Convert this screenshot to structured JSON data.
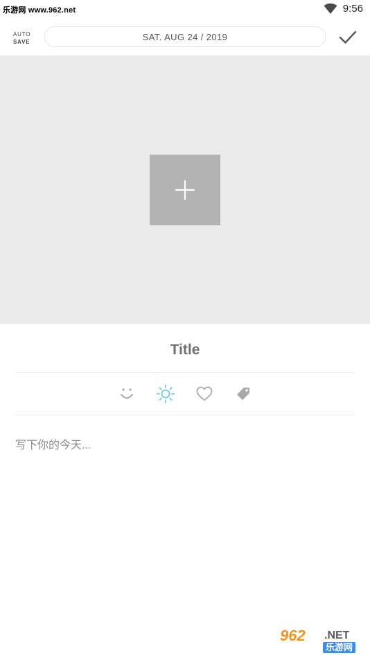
{
  "status_bar": {
    "watermark": "乐游网 www.962.net",
    "time": "9:56"
  },
  "toolbar": {
    "autosave_line1": "AUTO",
    "autosave_line2": "SAVE",
    "date": "SAT. AUG 24 / 2019",
    "confirm_icon": "checkmark-icon"
  },
  "photo": {
    "add_icon": "plus-icon",
    "placeholder_bg": "#ebebeb",
    "button_bg": "#b3b3b3"
  },
  "entry": {
    "title": "Title",
    "body_placeholder": "写下你的今天..."
  },
  "icons": [
    {
      "name": "mood-icon",
      "color": "#a8a8a8"
    },
    {
      "name": "weather-sun-icon",
      "color": "#5bc7e6"
    },
    {
      "name": "heart-icon",
      "color": "#a8a8a8"
    },
    {
      "name": "tag-icon",
      "color": "#a8a8a8"
    }
  ],
  "logo": {
    "brand": "962",
    "suffix": ".NET",
    "cn": "乐游网"
  }
}
